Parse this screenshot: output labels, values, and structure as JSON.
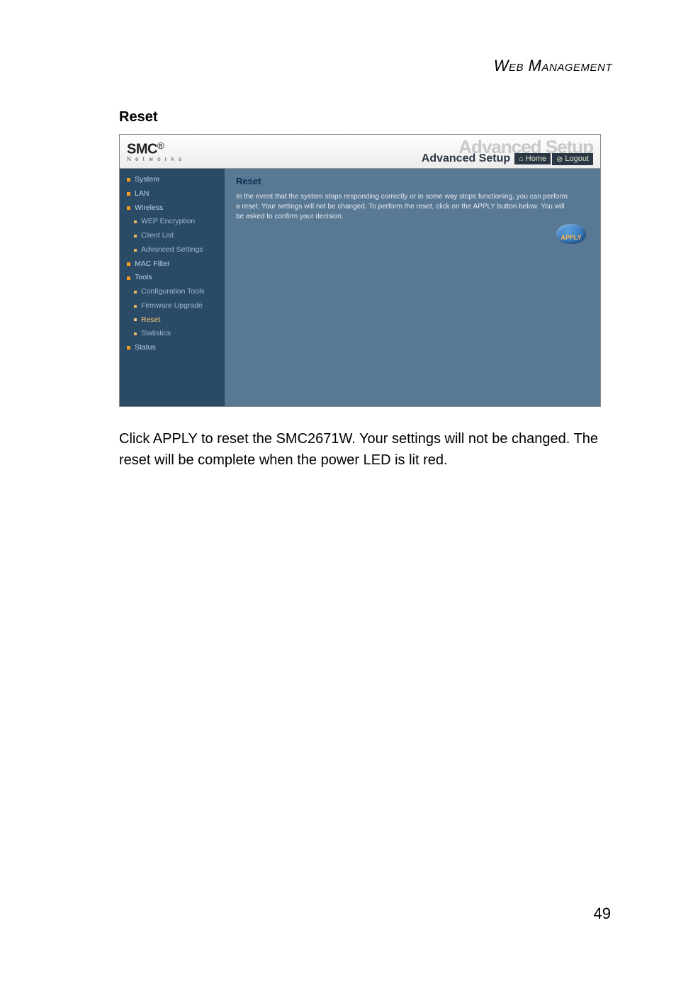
{
  "doc": {
    "header": "Web Management",
    "section": "Reset",
    "body": "Click APPLY to reset the SMC2671W. Your settings will not be changed. The reset will be complete when the power LED is lit red.",
    "page_number": "49"
  },
  "ui": {
    "logo": {
      "brand": "SMC",
      "reg": "®",
      "sub": "N e t w o r k s"
    },
    "banner": {
      "ghost": "Advanced Setup",
      "label": "Advanced Setup",
      "home": "Home",
      "logout": "Logout"
    },
    "sidebar": {
      "system": "System",
      "lan": "LAN",
      "wireless": "Wireless",
      "wep": "WEP Encryption",
      "clientlist": "Client List",
      "advset": "Advanced Settings",
      "macfilter": "MAC Filter",
      "tools": "Tools",
      "conftools": "Configuration Tools",
      "firmware": "Firmware Upgrade",
      "reset": "Reset",
      "stats": "Statistics",
      "status": "Status"
    },
    "content": {
      "title": "Reset",
      "desc": "In the event that the system stops responding correctly or in some way stops functioning, you can perform a reset. Your settings will not be changed. To perform the reset, click on the APPLY button below. You will be asked to confirm your decision.",
      "apply": "APPLY"
    }
  }
}
